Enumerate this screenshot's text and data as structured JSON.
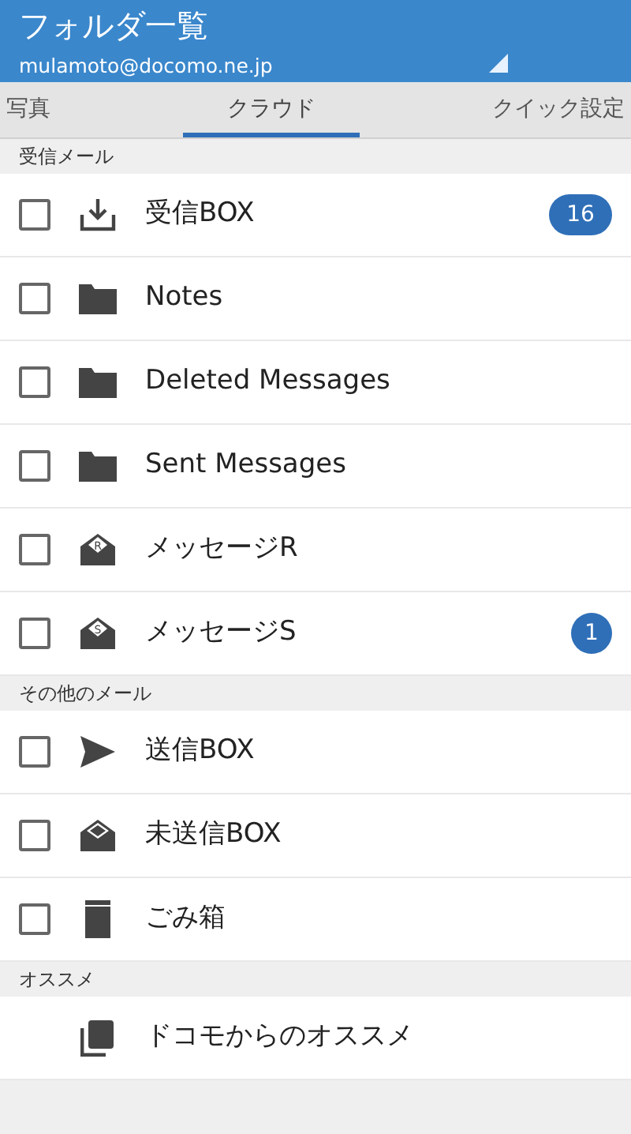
{
  "header": {
    "title": "フォルダ一覧",
    "account": "mulamoto@docomo.ne.jp"
  },
  "tabs": [
    {
      "label": "写真",
      "selected": false
    },
    {
      "label": "クラウド",
      "selected": true
    },
    {
      "label": "クイック設定",
      "selected": false
    }
  ],
  "sections": [
    {
      "title": "受信メール",
      "items": [
        {
          "kind": "inbox",
          "label": "受信BOX",
          "checked": false,
          "count": "16"
        },
        {
          "kind": "folder",
          "label": "Notes",
          "checked": false
        },
        {
          "kind": "folder",
          "label": "Deleted Messages",
          "checked": false
        },
        {
          "kind": "folder",
          "label": "Sent Messages",
          "checked": false
        },
        {
          "kind": "message",
          "icon_letter": "R",
          "label": "メッセージR",
          "checked": false
        },
        {
          "kind": "message",
          "icon_letter": "S",
          "label": "メッセージS",
          "checked": false,
          "count": "1"
        }
      ]
    },
    {
      "title": "その他のメール",
      "items": [
        {
          "kind": "send",
          "label": "送信BOX",
          "checked": false
        },
        {
          "kind": "draft",
          "label": "未送信BOX",
          "checked": false
        },
        {
          "kind": "trash",
          "label": "ごみ箱",
          "checked": false
        }
      ]
    },
    {
      "title": "オススメ",
      "items": [
        {
          "kind": "recommend",
          "label": "ドコモからのオススメ"
        }
      ]
    }
  ]
}
